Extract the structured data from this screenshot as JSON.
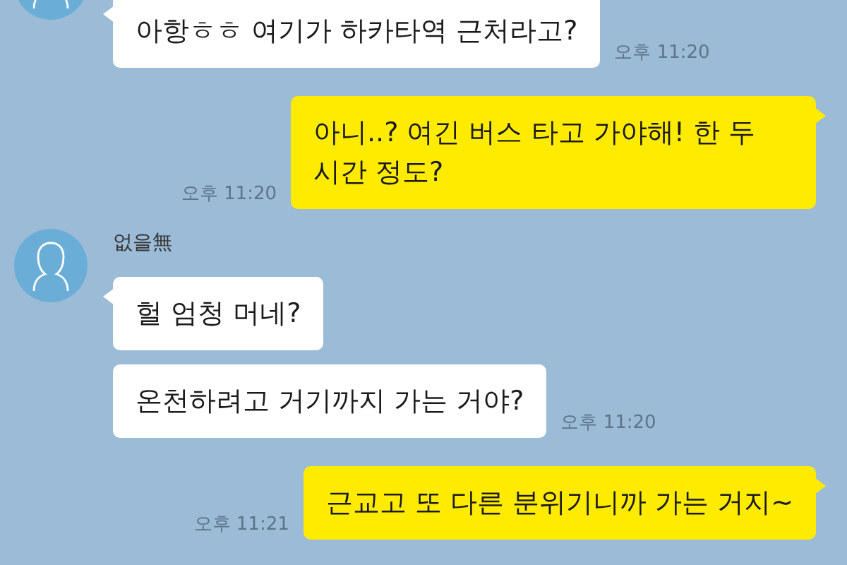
{
  "groups": [
    {
      "kind": "incoming",
      "messages": [
        {
          "text": "아항ㅎㅎ 여기가 하카타역 근처라고?",
          "time": "오후 11:20"
        }
      ]
    },
    {
      "kind": "outgoing",
      "messages": [
        {
          "text": "아니..? 여긴 버스 타고 가야해! 한 두 시간 정도?",
          "time": "오후 11:20"
        }
      ]
    },
    {
      "kind": "incoming",
      "sender": "없을無",
      "messages": [
        {
          "text": "헐 엄청 머네?"
        },
        {
          "text": "온천하려고 거기까지 가는 거야?",
          "time": "오후 11:20"
        }
      ]
    },
    {
      "kind": "outgoing",
      "messages": [
        {
          "text": "근교고 또 다른 분위기니까 가는 거지~",
          "time": "오후 11:21"
        }
      ]
    }
  ]
}
